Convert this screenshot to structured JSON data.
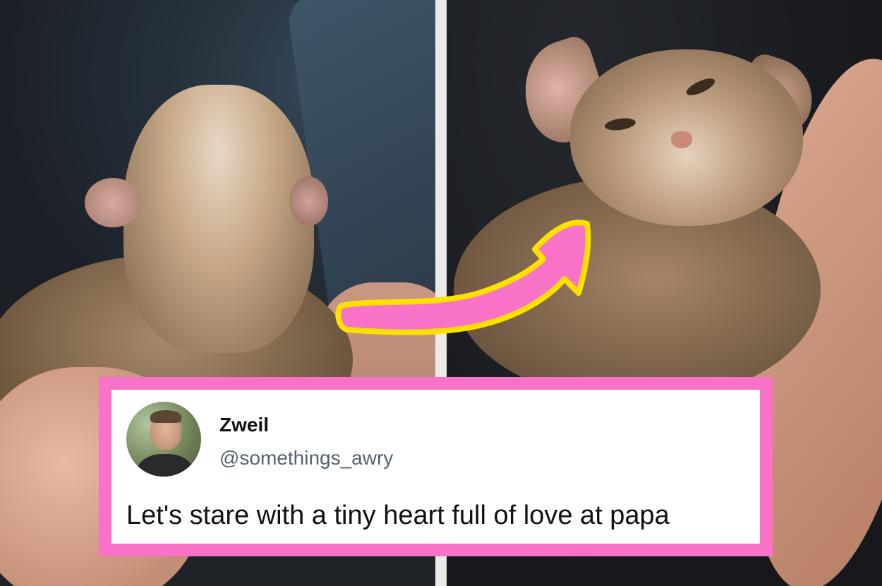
{
  "images": {
    "left": {
      "subject": "cat-raising-chin"
    },
    "right": {
      "subject": "cat-squinting-smile"
    }
  },
  "arrow": {
    "fill": "#f873c7",
    "outline": "#ffe100"
  },
  "tweet": {
    "border_color": "#f873c7",
    "display_name": "Zweil",
    "handle": "@somethings_awry",
    "text": "Let's stare with a tiny heart full of love at papa"
  }
}
